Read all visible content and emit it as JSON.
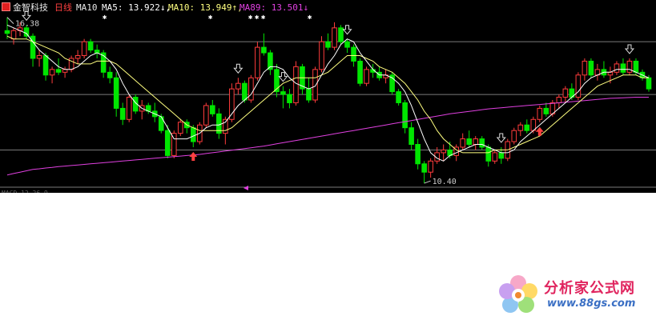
{
  "header": {
    "stock_name": "金智科技",
    "period": "日线",
    "indicator": "MA10",
    "ma5_label": "MA5: 13.922↓,",
    "ma10_label": "MA10: 13.949↑,",
    "ma89_label": "MA89: 13.501↓"
  },
  "colors": {
    "background": "#000000",
    "up": "#ff3c3c",
    "down": "#00e600",
    "ma5": "#ffffff",
    "ma10": "#ffff80",
    "ma89": "#e040e0",
    "grid": "#7a7a7a"
  },
  "chart_data": {
    "type": "candlestick",
    "ylim": [
      10.2,
      16.6
    ],
    "gridlines": [
      11.6,
      13.6,
      15.5
    ],
    "high_label": "16.38",
    "low_label": "10.40",
    "bottom_label": "MACD 12.26.9",
    "ohlc": [
      [
        15.9,
        16.38,
        15.6,
        15.8
      ],
      [
        15.6,
        16.0,
        15.4,
        15.9
      ],
      [
        15.9,
        16.2,
        15.7,
        16.0
      ],
      [
        16.0,
        16.1,
        15.6,
        15.7
      ],
      [
        15.7,
        15.8,
        14.6,
        14.9
      ],
      [
        14.9,
        15.2,
        14.6,
        15.0
      ],
      [
        15.0,
        15.1,
        14.1,
        14.3
      ],
      [
        14.3,
        14.6,
        14.0,
        14.5
      ],
      [
        14.5,
        14.9,
        14.3,
        14.4
      ],
      [
        14.4,
        14.6,
        14.2,
        14.5
      ],
      [
        14.5,
        15.0,
        14.4,
        14.9
      ],
      [
        14.9,
        15.2,
        14.7,
        15.0
      ],
      [
        15.0,
        15.6,
        14.9,
        15.5
      ],
      [
        15.5,
        15.6,
        15.1,
        15.2
      ],
      [
        15.2,
        15.4,
        14.9,
        15.1
      ],
      [
        15.1,
        15.2,
        14.2,
        14.4
      ],
      [
        14.4,
        14.6,
        14.0,
        14.2
      ],
      [
        14.2,
        14.4,
        12.8,
        13.1
      ],
      [
        13.1,
        13.3,
        12.5,
        12.7
      ],
      [
        12.7,
        13.6,
        12.6,
        13.5
      ],
      [
        13.5,
        13.6,
        12.9,
        13.0
      ],
      [
        13.0,
        13.4,
        12.7,
        13.2
      ],
      [
        13.2,
        13.3,
        12.9,
        13.0
      ],
      [
        13.0,
        13.3,
        12.6,
        12.8
      ],
      [
        12.8,
        12.9,
        12.2,
        12.3
      ],
      [
        12.3,
        12.5,
        11.3,
        11.4
      ],
      [
        11.4,
        12.3,
        11.3,
        12.2
      ],
      [
        12.2,
        12.7,
        12.1,
        12.6
      ],
      [
        12.6,
        12.7,
        12.2,
        12.4
      ],
      [
        12.4,
        12.5,
        11.7,
        11.9
      ],
      [
        11.9,
        12.6,
        11.8,
        12.5
      ],
      [
        12.5,
        13.3,
        12.4,
        13.2
      ],
      [
        13.2,
        13.4,
        12.8,
        12.9
      ],
      [
        12.9,
        13.1,
        12.0,
        12.2
      ],
      [
        12.2,
        12.8,
        11.8,
        12.7
      ],
      [
        12.7,
        14.0,
        12.6,
        13.8
      ],
      [
        13.8,
        14.2,
        13.6,
        14.0
      ],
      [
        14.0,
        14.1,
        13.3,
        13.4
      ],
      [
        13.4,
        14.3,
        13.3,
        14.2
      ],
      [
        14.2,
        15.5,
        14.1,
        15.3
      ],
      [
        15.3,
        15.8,
        15.0,
        15.1
      ],
      [
        15.1,
        15.2,
        14.3,
        14.5
      ],
      [
        14.5,
        14.7,
        13.5,
        13.7
      ],
      [
        13.7,
        13.9,
        13.1,
        13.6
      ],
      [
        13.6,
        13.8,
        13.1,
        13.3
      ],
      [
        13.3,
        14.8,
        13.2,
        14.6
      ],
      [
        14.6,
        14.7,
        13.6,
        13.8
      ],
      [
        13.8,
        14.2,
        13.3,
        13.4
      ],
      [
        13.4,
        14.6,
        13.3,
        14.5
      ],
      [
        14.5,
        15.7,
        14.4,
        15.5
      ],
      [
        15.5,
        15.8,
        15.2,
        15.3
      ],
      [
        15.3,
        16.2,
        15.2,
        16.0
      ],
      [
        16.0,
        16.1,
        15.4,
        15.5
      ],
      [
        15.5,
        15.6,
        15.1,
        15.3
      ],
      [
        15.3,
        15.4,
        14.6,
        14.8
      ],
      [
        14.8,
        14.9,
        13.9,
        14.0
      ],
      [
        14.0,
        14.6,
        13.9,
        14.5
      ],
      [
        14.5,
        14.7,
        14.2,
        14.4
      ],
      [
        14.4,
        14.6,
        14.1,
        14.2
      ],
      [
        14.2,
        14.5,
        14.0,
        14.3
      ],
      [
        14.3,
        14.4,
        13.6,
        13.7
      ],
      [
        13.7,
        13.8,
        13.2,
        13.3
      ],
      [
        13.3,
        13.4,
        12.2,
        12.4
      ],
      [
        12.4,
        12.6,
        11.6,
        11.8
      ],
      [
        11.8,
        12.0,
        10.9,
        11.1
      ],
      [
        11.1,
        11.2,
        10.4,
        10.8
      ],
      [
        10.8,
        11.3,
        10.6,
        11.2
      ],
      [
        11.2,
        11.7,
        11.1,
        11.5
      ],
      [
        11.5,
        11.8,
        11.2,
        11.6
      ],
      [
        11.6,
        11.9,
        11.3,
        11.4
      ],
      [
        11.4,
        11.8,
        11.2,
        11.7
      ],
      [
        11.7,
        12.2,
        11.6,
        12.0
      ],
      [
        12.0,
        12.3,
        11.7,
        11.8
      ],
      [
        11.8,
        12.1,
        11.6,
        12.0
      ],
      [
        12.0,
        12.1,
        11.6,
        11.7
      ],
      [
        11.7,
        11.8,
        11.0,
        11.2
      ],
      [
        11.2,
        11.6,
        11.1,
        11.5
      ],
      [
        11.5,
        11.7,
        11.1,
        11.3
      ],
      [
        11.3,
        12.0,
        11.2,
        11.9
      ],
      [
        11.9,
        12.4,
        11.8,
        12.3
      ],
      [
        12.3,
        12.6,
        12.1,
        12.5
      ],
      [
        12.5,
        12.7,
        12.2,
        12.3
      ],
      [
        12.3,
        12.8,
        12.2,
        12.7
      ],
      [
        12.7,
        13.2,
        12.6,
        13.1
      ],
      [
        13.1,
        13.3,
        12.8,
        12.9
      ],
      [
        12.9,
        13.4,
        12.8,
        13.3
      ],
      [
        13.3,
        13.6,
        13.1,
        13.5
      ],
      [
        13.5,
        13.9,
        13.3,
        13.8
      ],
      [
        13.8,
        14.0,
        13.4,
        13.5
      ],
      [
        13.5,
        14.4,
        13.4,
        14.3
      ],
      [
        14.3,
        14.9,
        14.1,
        14.8
      ],
      [
        14.8,
        14.9,
        14.2,
        14.3
      ],
      [
        14.3,
        14.7,
        14.1,
        14.5
      ],
      [
        14.5,
        14.8,
        14.2,
        14.3
      ],
      [
        14.3,
        14.6,
        14.0,
        14.4
      ],
      [
        14.4,
        14.8,
        14.3,
        14.7
      ],
      [
        14.7,
        14.9,
        14.3,
        14.4
      ],
      [
        14.4,
        14.9,
        14.3,
        14.8
      ],
      [
        14.8,
        14.9,
        14.3,
        14.4
      ],
      [
        14.4,
        14.5,
        14.1,
        14.2
      ],
      [
        14.2,
        14.3,
        13.7,
        13.8
      ]
    ],
    "ma5": [
      16.1,
      16.0,
      15.9,
      15.8,
      15.5,
      15.2,
      15.0,
      14.8,
      14.6,
      14.5,
      14.5,
      14.6,
      14.8,
      15.0,
      15.1,
      15.0,
      14.8,
      14.5,
      14.0,
      13.6,
      13.3,
      13.1,
      13.0,
      12.9,
      12.8,
      12.4,
      12.0,
      12.0,
      12.0,
      12.1,
      12.2,
      12.4,
      12.5,
      12.5,
      12.6,
      12.9,
      13.2,
      13.4,
      13.6,
      14.0,
      14.4,
      14.6,
      14.6,
      14.5,
      14.2,
      14.0,
      13.9,
      13.8,
      13.9,
      14.3,
      14.7,
      15.0,
      15.4,
      15.6,
      15.5,
      15.1,
      14.8,
      14.5,
      14.3,
      14.3,
      14.2,
      14.0,
      13.7,
      13.2,
      12.6,
      12.0,
      11.5,
      11.3,
      11.2,
      11.4,
      11.5,
      11.6,
      11.7,
      11.8,
      11.8,
      11.7,
      11.6,
      11.5,
      11.5,
      11.6,
      11.9,
      12.1,
      12.3,
      12.5,
      12.7,
      12.9,
      13.1,
      13.3,
      13.5,
      13.7,
      14.0,
      14.2,
      14.3,
      14.4,
      14.4,
      14.5,
      14.5,
      14.5,
      14.4,
      14.3,
      14.2
    ],
    "ma10": [
      15.7,
      15.6,
      15.6,
      15.6,
      15.5,
      15.4,
      15.3,
      15.2,
      15.1,
      14.9,
      14.8,
      14.7,
      14.7,
      14.7,
      14.8,
      14.8,
      14.8,
      14.7,
      14.5,
      14.3,
      14.1,
      13.9,
      13.7,
      13.5,
      13.3,
      13.1,
      12.9,
      12.7,
      12.5,
      12.4,
      12.3,
      12.3,
      12.3,
      12.3,
      12.3,
      12.4,
      12.6,
      12.8,
      13.0,
      13.2,
      13.4,
      13.6,
      13.8,
      14.0,
      14.1,
      14.2,
      14.2,
      14.2,
      14.2,
      14.3,
      14.4,
      14.6,
      14.8,
      15.0,
      15.0,
      15.0,
      14.9,
      14.8,
      14.6,
      14.5,
      14.4,
      14.2,
      14.0,
      13.7,
      13.4,
      13.0,
      12.7,
      12.3,
      12.0,
      11.8,
      11.6,
      11.5,
      11.5,
      11.5,
      11.5,
      11.5,
      11.6,
      11.6,
      11.6,
      11.7,
      11.8,
      11.9,
      12.0,
      12.1,
      12.3,
      12.5,
      12.7,
      12.9,
      13.1,
      13.3,
      13.5,
      13.7,
      13.9,
      14.0,
      14.1,
      14.2,
      14.3,
      14.3,
      14.3,
      14.2,
      14.2
    ],
    "ma89": [
      10.7,
      10.75,
      10.8,
      10.85,
      10.9,
      10.92,
      10.95,
      10.97,
      11.0,
      11.02,
      11.04,
      11.06,
      11.08,
      11.1,
      11.12,
      11.14,
      11.16,
      11.18,
      11.2,
      11.22,
      11.24,
      11.26,
      11.28,
      11.3,
      11.32,
      11.34,
      11.36,
      11.38,
      11.4,
      11.42,
      11.44,
      11.47,
      11.5,
      11.53,
      11.56,
      11.59,
      11.62,
      11.65,
      11.68,
      11.71,
      11.74,
      11.78,
      11.82,
      11.86,
      11.9,
      11.94,
      11.98,
      12.02,
      12.06,
      12.1,
      12.14,
      12.18,
      12.22,
      12.26,
      12.3,
      12.34,
      12.38,
      12.42,
      12.46,
      12.5,
      12.54,
      12.58,
      12.62,
      12.66,
      12.7,
      12.74,
      12.78,
      12.82,
      12.86,
      12.9,
      12.93,
      12.96,
      12.99,
      13.02,
      13.05,
      13.08,
      13.1,
      13.12,
      13.14,
      13.16,
      13.18,
      13.2,
      13.22,
      13.24,
      13.26,
      13.28,
      13.3,
      13.32,
      13.34,
      13.36,
      13.38,
      13.4,
      13.42,
      13.44,
      13.46,
      13.47,
      13.48,
      13.49,
      13.5,
      13.5,
      13.501
    ],
    "signals": [
      {
        "type": "sell",
        "index": 3
      },
      {
        "type": "buy",
        "index": 29
      },
      {
        "type": "sell",
        "index": 36
      },
      {
        "type": "sell",
        "index": 43
      },
      {
        "type": "sell",
        "index": 53
      },
      {
        "type": "buy",
        "index": 83
      },
      {
        "type": "sell",
        "index": 77
      },
      {
        "type": "sell",
        "index": 97
      }
    ]
  },
  "watermark": {
    "title": "分析家公式网",
    "url": "www.88gs.com"
  }
}
